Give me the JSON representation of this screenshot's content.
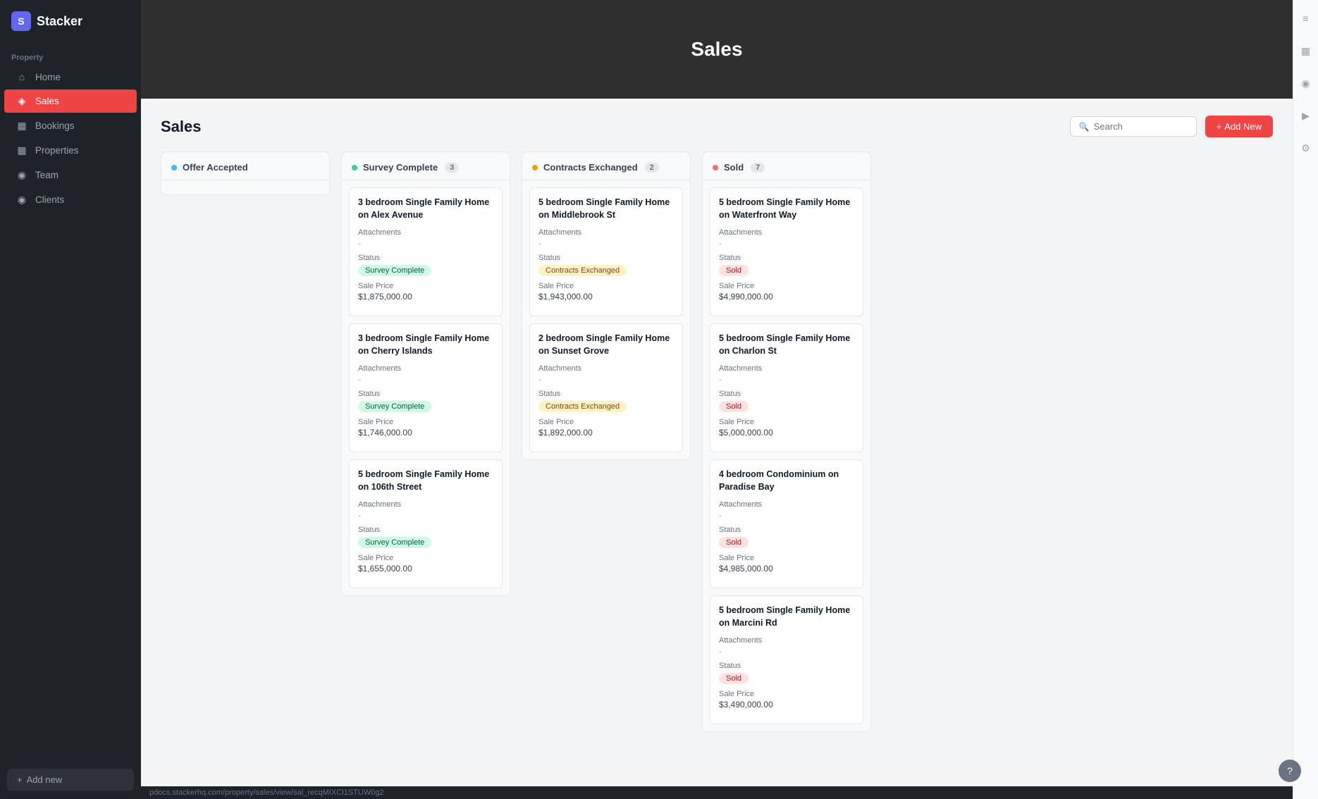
{
  "app": {
    "name": "Stacker"
  },
  "sidebar": {
    "section_label": "Property",
    "items": [
      {
        "id": "home",
        "label": "Home",
        "icon": "⌂",
        "active": false
      },
      {
        "id": "sales",
        "label": "Sales",
        "icon": "◈",
        "active": true
      },
      {
        "id": "bookings",
        "label": "Bookings",
        "icon": "▦",
        "active": false
      },
      {
        "id": "properties",
        "label": "Properties",
        "icon": "▦",
        "active": false
      },
      {
        "id": "team",
        "label": "Team",
        "icon": "◉",
        "active": false
      },
      {
        "id": "clients",
        "label": "Clients",
        "icon": "◉",
        "active": false
      }
    ],
    "add_new_label": "+ Add new"
  },
  "hero": {
    "title": "Sales"
  },
  "board": {
    "title": "Sales",
    "search_placeholder": "Search",
    "add_new_label": "+ Add New",
    "columns": [
      {
        "id": "offer-accepted",
        "label": "Offer Accepted",
        "dot_color": "#38bdf8",
        "count": null,
        "cards": []
      },
      {
        "id": "survey-complete",
        "label": "Survey Complete",
        "dot_color": "#34d399",
        "count": "3",
        "cards": [
          {
            "title": "3 bedroom Single Family Home on Alex Avenue",
            "attachments_label": "Attachments",
            "attachments_value": "-",
            "status_label": "Status",
            "status_value": "Survey Complete",
            "status_badge_class": "badge-survey",
            "sale_price_label": "Sale Price",
            "sale_price_value": "$1,875,000.00"
          },
          {
            "title": "3 bedroom Single Family Home on Cherry Islands",
            "attachments_label": "Attachments",
            "attachments_value": "-",
            "status_label": "Status",
            "status_value": "Survey Complete",
            "status_badge_class": "badge-survey",
            "sale_price_label": "Sale Price",
            "sale_price_value": "$1,746,000.00"
          },
          {
            "title": "5 bedroom Single Family Home on 106th Street",
            "attachments_label": "Attachments",
            "attachments_value": "-",
            "status_label": "Status",
            "status_value": "Survey Complete",
            "status_badge_class": "badge-survey",
            "sale_price_label": "Sale Price",
            "sale_price_value": "$1,655,000.00"
          }
        ]
      },
      {
        "id": "contracts-exchanged",
        "label": "Contracts Exchanged",
        "dot_color": "#f59e0b",
        "count": "2",
        "cards": [
          {
            "title": "5 bedroom Single Family Home on Middlebrook St",
            "attachments_label": "Attachments",
            "attachments_value": "-",
            "status_label": "Status",
            "status_value": "Contracts Exchanged",
            "status_badge_class": "badge-contracts",
            "sale_price_label": "Sale Price",
            "sale_price_value": "$1,943,000.00"
          },
          {
            "title": "2 bedroom Single Family Home on Sunset Grove",
            "attachments_label": "Attachments",
            "attachments_value": "-",
            "status_label": "Status",
            "status_value": "Contracts Exchanged",
            "status_badge_class": "badge-contracts",
            "sale_price_label": "Sale Price",
            "sale_price_value": "$1,892,000.00"
          }
        ]
      },
      {
        "id": "sold",
        "label": "Sold",
        "dot_color": "#f87171",
        "count": "7",
        "cards": [
          {
            "title": "5 bedroom Single Family Home on Waterfront Way",
            "attachments_label": "Attachments",
            "attachments_value": "-",
            "status_label": "Status",
            "status_value": "Sold",
            "status_badge_class": "badge-sold",
            "sale_price_label": "Sale Price",
            "sale_price_value": "$4,990,000.00"
          },
          {
            "title": "5 bedroom Single Family Home on Charlon St",
            "attachments_label": "Attachments",
            "attachments_value": "-",
            "status_label": "Status",
            "status_value": "Sold",
            "status_badge_class": "badge-sold",
            "sale_price_label": "Sale Price",
            "sale_price_value": "$5,000,000.00"
          },
          {
            "title": "4 bedroom Condominium on Paradise Bay",
            "attachments_label": "Attachments",
            "attachments_value": "-",
            "status_label": "Status",
            "status_value": "Sold",
            "status_badge_class": "badge-sold",
            "sale_price_label": "Sale Price",
            "sale_price_value": "$4,985,000.00"
          },
          {
            "title": "5 bedroom Single Family Home on Marcini Rd",
            "attachments_label": "Attachments",
            "attachments_value": "-",
            "status_label": "Status",
            "status_value": "Sold",
            "status_badge_class": "badge-sold",
            "sale_price_label": "Sale Price",
            "sale_price_value": "$3,490,000.00"
          }
        ]
      }
    ]
  },
  "right_panel": {
    "icons": [
      "≡",
      "▦",
      "◉",
      "▶",
      "⚙"
    ]
  },
  "status_bar": {
    "url": "pdocs.stackerhq.com/property/sales/view/sal_recqMIXCl1STUW0g2"
  }
}
